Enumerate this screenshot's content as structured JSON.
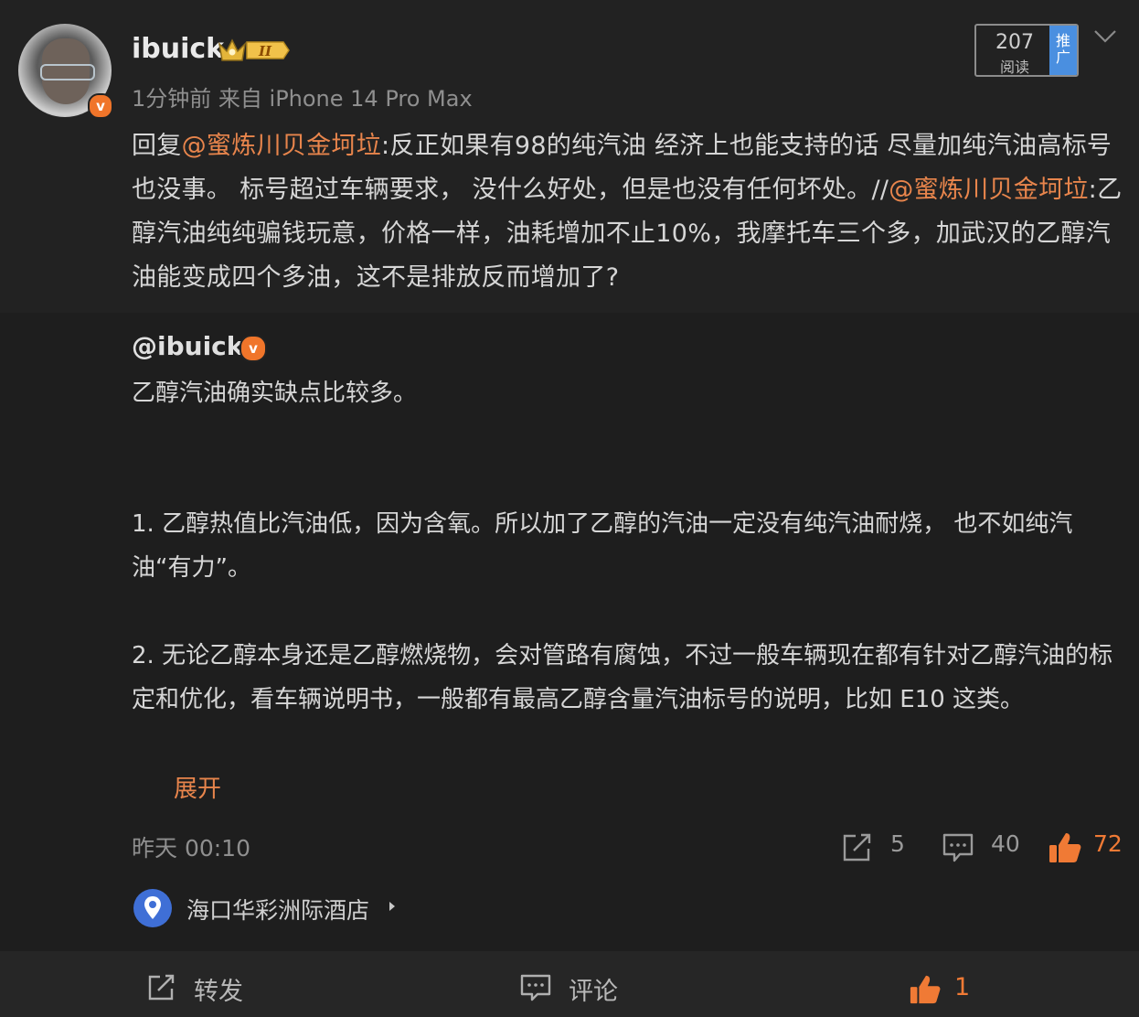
{
  "post": {
    "username": "ibuick",
    "level_badge": "II",
    "meta": "1分钟前  来自 iPhone 14 Pro Max",
    "reads": {
      "count": "207",
      "label": "阅读",
      "promo_label": "推广"
    },
    "text": {
      "reply_prefix": "回复",
      "mention1": "@蜜炼川贝金坷垃",
      "part1": ":反正如果有98的纯汽油 经济上也能支持的话 尽量加纯汽油高标号也没事。 标号超过车辆要求， 没什么好处，但是也没有任何坏处。//",
      "mention2": "@蜜炼川贝金坷垃",
      "part2": ":乙醇汽油纯纯骗钱玩意，价格一样，油耗增加不止10%，我摩托车三个多，加武汉的乙醇汽油能变成四个多油，这不是排放反而增加了?"
    }
  },
  "reply": {
    "username": "@ibuick",
    "intro": "乙醇汽油确实缺点比较多。",
    "point1": "1. 乙醇热值比汽油低，因为含氧。所以加了乙醇的汽油一定没有纯汽油耐烧， 也不如纯汽油“有力”。",
    "point2": "2. 无论乙醇本身还是乙醇燃烧物，会对管路有腐蚀，不过一般车辆现在都有针对乙醇汽油的标定和优化，看车辆说明书，一般都有最高乙醇含量汽油标号的说明，比如 E10 这类。",
    "expand_label": "展开",
    "time": "昨天 00:10",
    "reposts": "5",
    "comments": "40",
    "likes": "72"
  },
  "location": {
    "name": "海口华彩洲际酒店",
    "icon": "location-pin-icon"
  },
  "bottom_bar": {
    "repost_label": "转发",
    "comment_label": "评论",
    "like_count": "1"
  },
  "colors": {
    "accent": "#e8854c",
    "like": "#f07a35",
    "promo": "#4a8fe0",
    "verified": "#f0752a"
  }
}
